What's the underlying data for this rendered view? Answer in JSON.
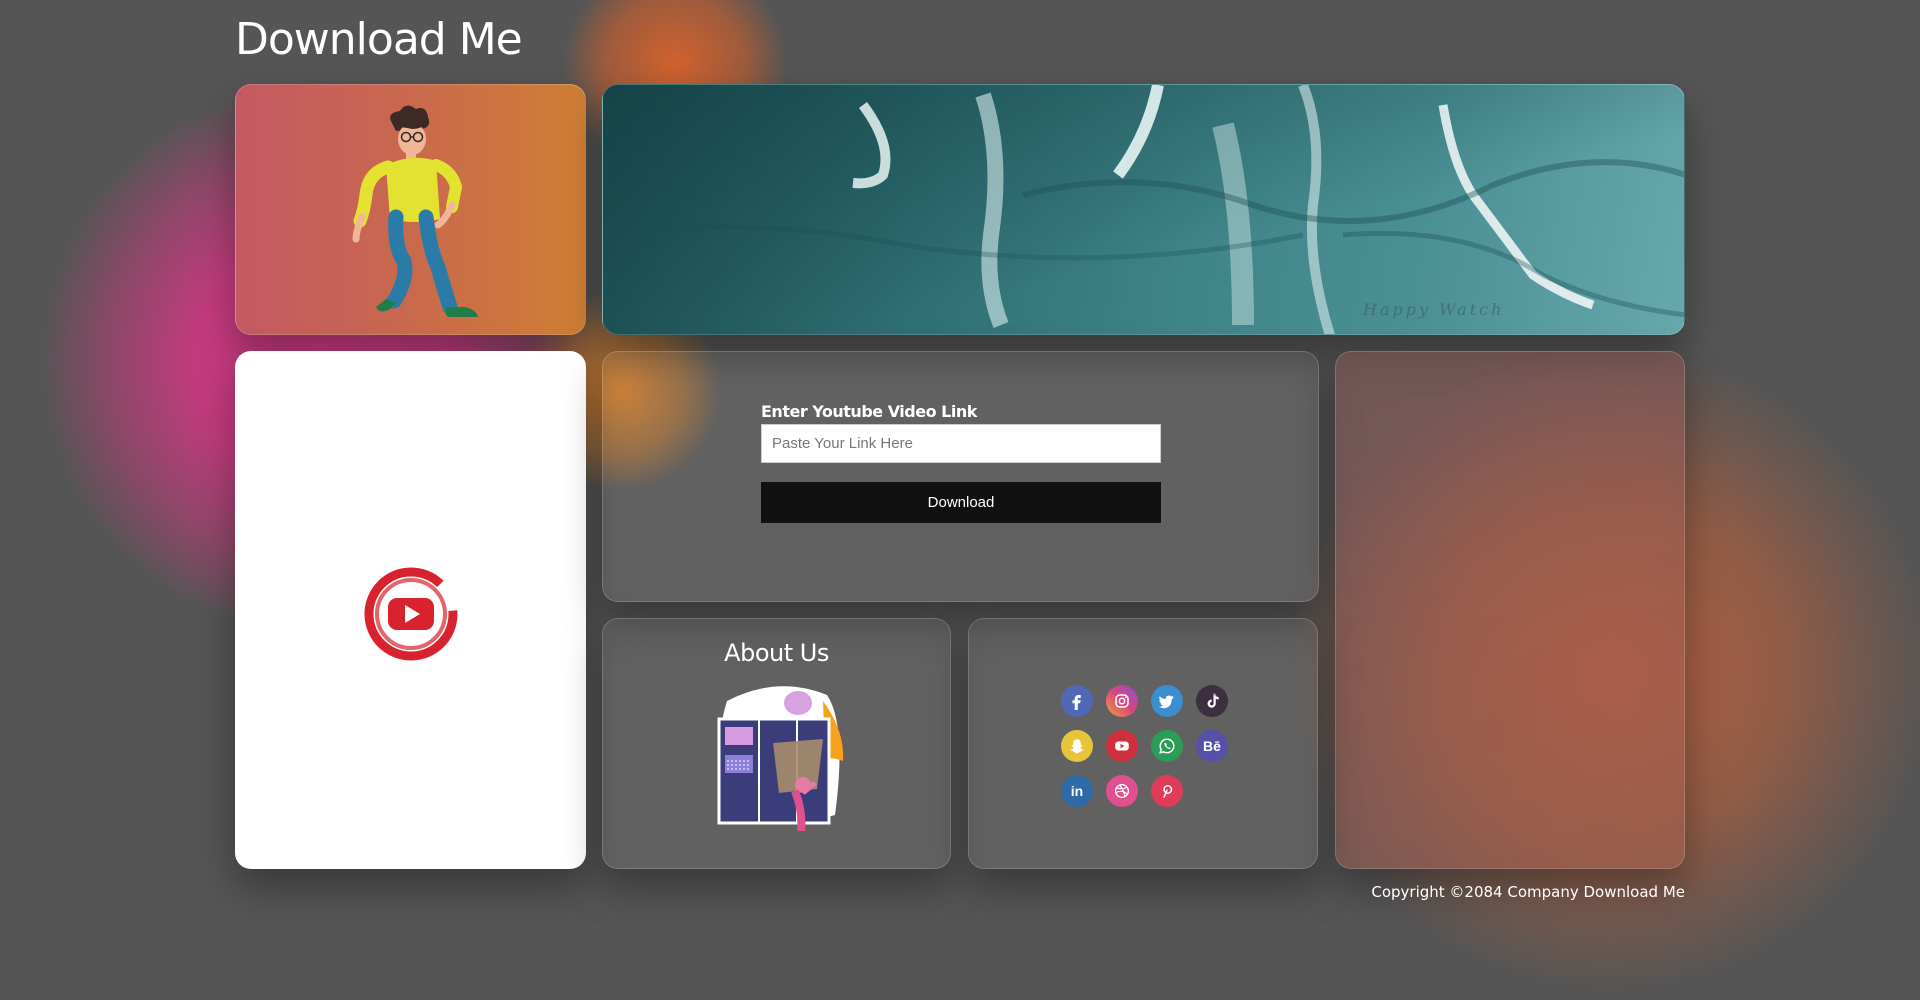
{
  "header": {
    "title": "Download Me"
  },
  "banner": {
    "watermark": "Happy Watch"
  },
  "form": {
    "label": "Enter Youtube Video Link",
    "input_placeholder": "Paste Your Link Here",
    "input_value": "",
    "button_label": "Download"
  },
  "about": {
    "title": "About Us"
  },
  "social": {
    "icons": [
      {
        "name": "facebook-icon",
        "color": "#5168b8"
      },
      {
        "name": "instagram-icon",
        "color": "#b956c9"
      },
      {
        "name": "twitter-icon",
        "color": "#3a8fd0"
      },
      {
        "name": "tiktok-icon",
        "color": "#3b2f40"
      },
      {
        "name": "snapchat-icon",
        "color": "#e8c43a"
      },
      {
        "name": "youtube-icon",
        "color": "#cf2f3c"
      },
      {
        "name": "whatsapp-icon",
        "color": "#2a9d56"
      },
      {
        "name": "behance-icon",
        "color": "#5650a8",
        "text": "Bē"
      },
      {
        "name": "linkedin-icon",
        "color": "#2e6aa8",
        "text": "in"
      },
      {
        "name": "dribbble-icon",
        "color": "#e0508f"
      },
      {
        "name": "pinterest-icon",
        "color": "#de3c57"
      }
    ]
  },
  "footer": {
    "copyright": "Copyright ©2084 Company Download Me"
  },
  "colors": {
    "background": "#555555",
    "button": "#111111",
    "youtube_red": "#d8222d"
  }
}
